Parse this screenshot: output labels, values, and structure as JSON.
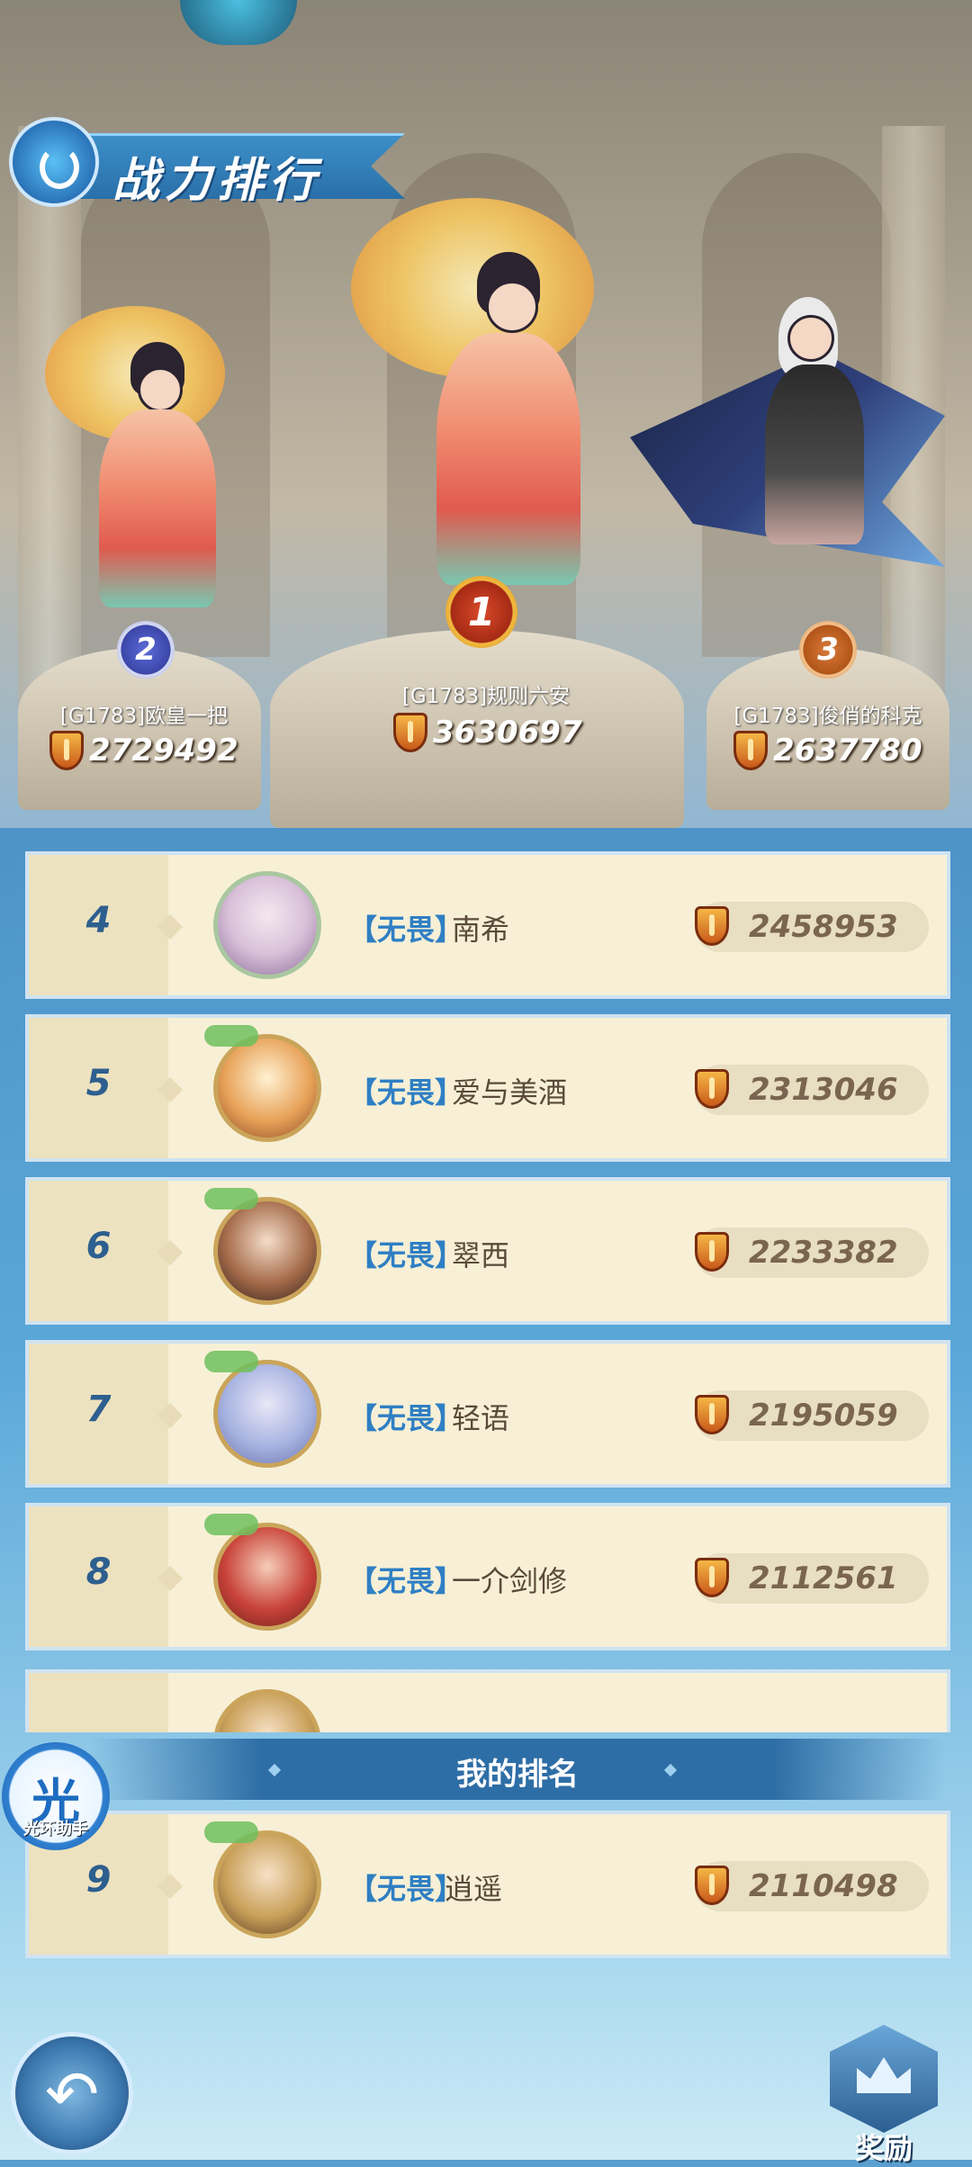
{
  "header": {
    "title": "战力排行"
  },
  "podium": [
    {
      "place": "1",
      "name": "[G1783]规则六安",
      "power": "3630697"
    },
    {
      "place": "2",
      "name": "[G1783]欧皇一把",
      "power": "2729492"
    },
    {
      "place": "3",
      "name": "[G1783]俊俏的科克",
      "power": "2637780"
    }
  ],
  "ranking_list": [
    {
      "rank": "4",
      "guild": "【无畏】",
      "name": "南希",
      "power": "2458953"
    },
    {
      "rank": "5",
      "guild": "【无畏】",
      "name": "爱与美酒",
      "power": "2313046"
    },
    {
      "rank": "6",
      "guild": "【无畏】",
      "name": "翠西",
      "power": "2233382"
    },
    {
      "rank": "7",
      "guild": "【无畏】",
      "name": "轻语",
      "power": "2195059"
    },
    {
      "rank": "8",
      "guild": "【无畏】",
      "name": "一介剑修",
      "power": "2112561"
    }
  ],
  "my_rank": {
    "section_label": "我的排名",
    "rank": "9",
    "guild": "【无畏】",
    "name": "逍遥",
    "power": "2110498"
  },
  "helper": {
    "char": "光",
    "label": "光环助手"
  },
  "footer": {
    "back_icon": "back-arrow-icon",
    "reward_label": "奖励"
  },
  "colors": {
    "guild_blue": "#2f7fc4",
    "rank_blue": "#2d5f8f",
    "row_bg": "#f7f0d6"
  }
}
